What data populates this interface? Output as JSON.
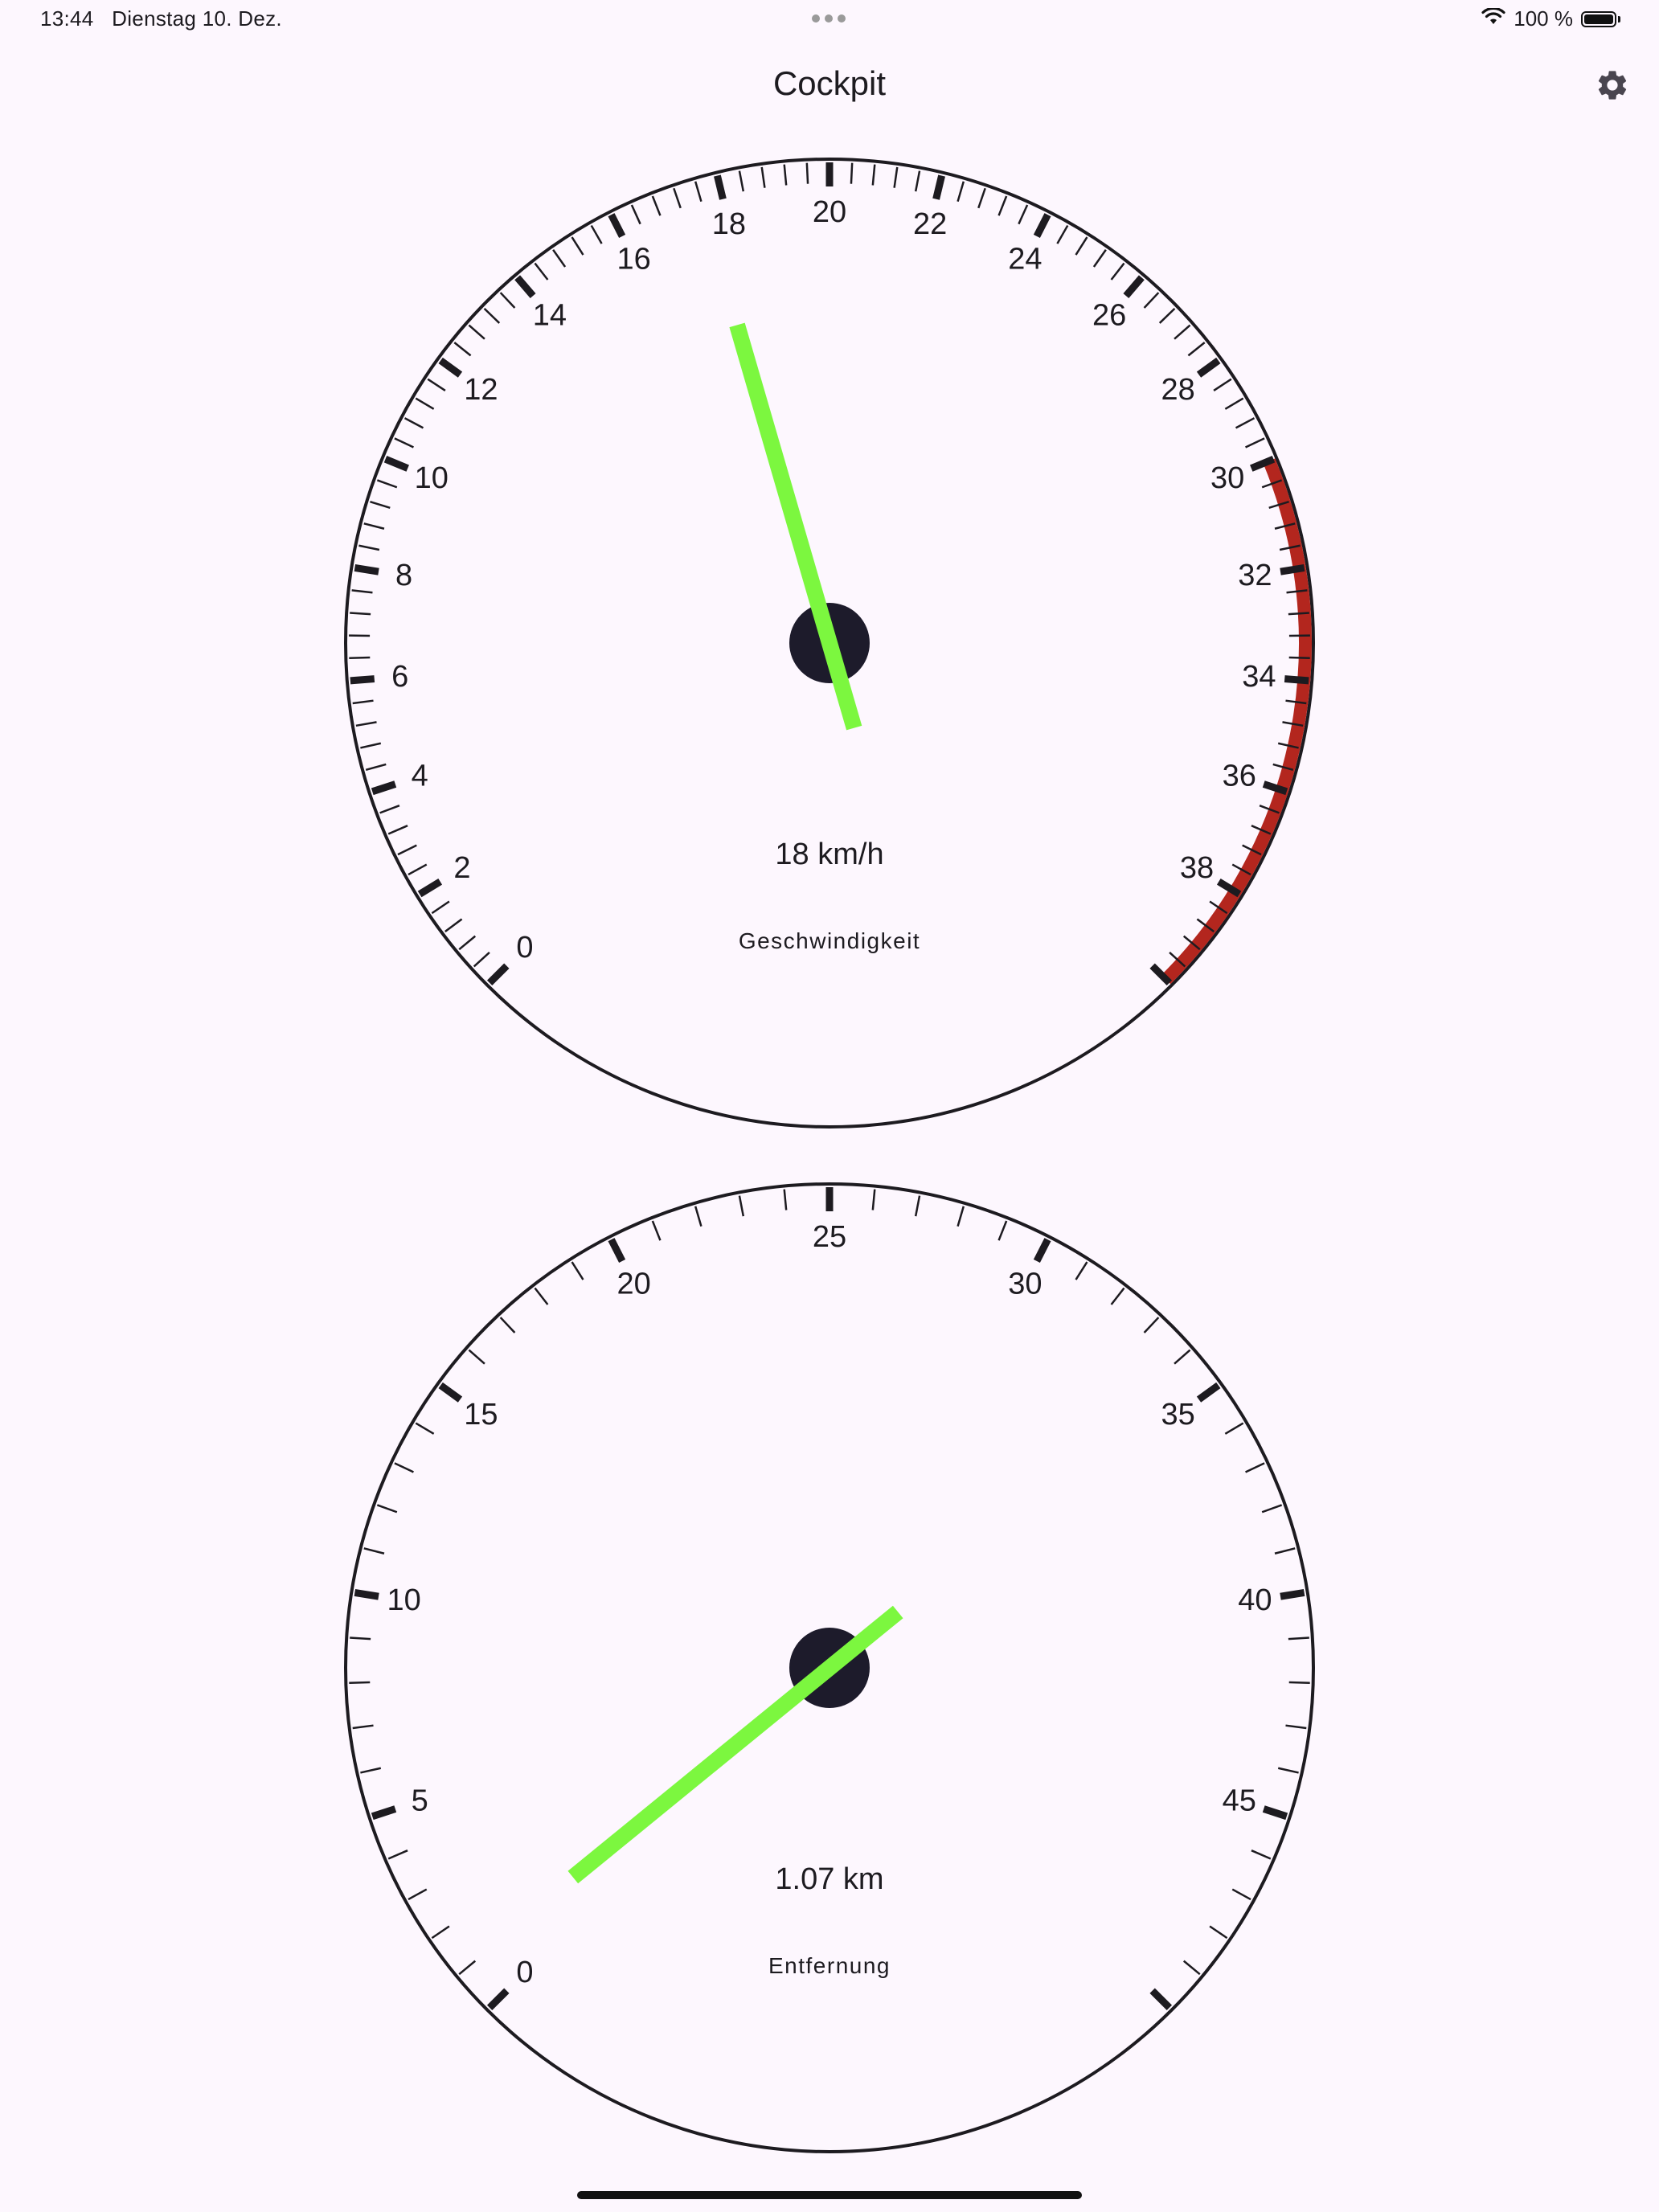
{
  "status_bar": {
    "time": "13:44",
    "date": "Dienstag 10. Dez.",
    "battery": "100 %",
    "icons": [
      "wifi-icon",
      "battery-icon",
      "multitask-dots-icon"
    ]
  },
  "app_bar": {
    "title": "Cockpit",
    "settings_icon": "gear-icon"
  },
  "colors": {
    "background": "#fdf7fe",
    "needle": "#7cf73f",
    "hub": "#1d1b2b",
    "redzone": "#b3261e",
    "ink": "#1d1b20"
  },
  "gauges": {
    "speed": {
      "value_text": "18 km/h",
      "label": "Geschwindigkeit",
      "min": 0,
      "max": 40,
      "major_step": 2,
      "minor_per_major": 5,
      "labels_shown": [
        "0",
        "2",
        "4",
        "6",
        "8",
        "10",
        "12",
        "14",
        "16",
        "18",
        "20",
        "22",
        "24",
        "26",
        "28",
        "30",
        "32",
        "34",
        "36",
        "38"
      ],
      "redzone": [
        30,
        40
      ],
      "value": 17.6
    },
    "distance": {
      "value_text": "1.07 km",
      "label": "Entfernung",
      "min": 0,
      "max": 50,
      "major_step": 5,
      "minor_per_major": 5,
      "labels_shown": [
        "0",
        "5",
        "10",
        "15",
        "20",
        "25",
        "30",
        "35",
        "40",
        "45"
      ],
      "value": 1.07
    }
  }
}
